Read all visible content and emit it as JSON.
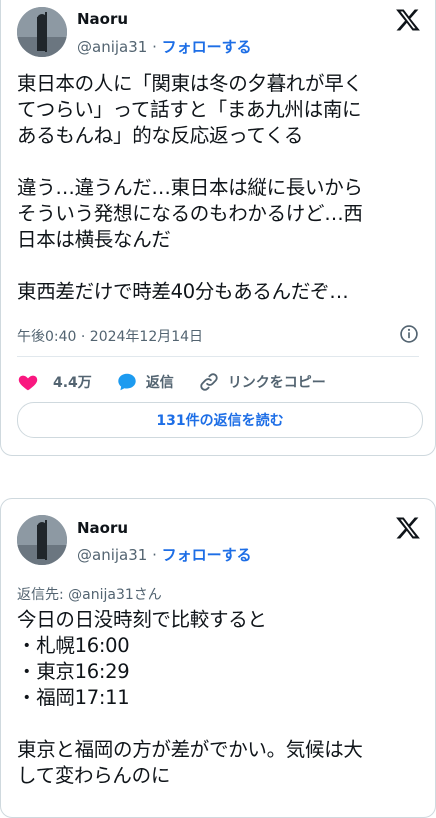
{
  "tweet1": {
    "author_name": "Naoru",
    "author_handle": "@anija31",
    "separator": "·",
    "follow_label": "フォローする",
    "body": "東日本の人に「関東は冬の夕暮れが早く\nてつらい」って話すと「まあ九州は南に\nあるもんね」的な反応返ってくる\n\n違う…違うんだ…東日本は縦に長いから\nそういう発想になるのもわかるけど…西\n日本は横長なんだ\n\n東西差だけで時差40分もあるんだぞ…",
    "timestamp": "午後0:40 · 2024年12月14日",
    "likes_count": "4.4万",
    "reply_label": "返信",
    "copy_link_label": "リンクをコピー",
    "read_replies_label": "131件の返信を読む"
  },
  "tweet2": {
    "author_name": "Naoru",
    "author_handle": "@anija31",
    "separator": "·",
    "follow_label": "フォローする",
    "reply_to": "返信先: @anija31さん",
    "body": "今日の日没時刻で比較すると\n・札幌16:00\n・東京16:29\n・福岡17:11\n\n東京と福岡の方が差がでかい。気候は大\nして変わらんのに"
  },
  "colors": {
    "accent": "#1d6ee6",
    "like": "#f91880",
    "muted": "#536471"
  },
  "icons": [
    "x-logo-icon",
    "info-icon",
    "heart-icon",
    "reply-bubble-icon",
    "link-icon"
  ]
}
